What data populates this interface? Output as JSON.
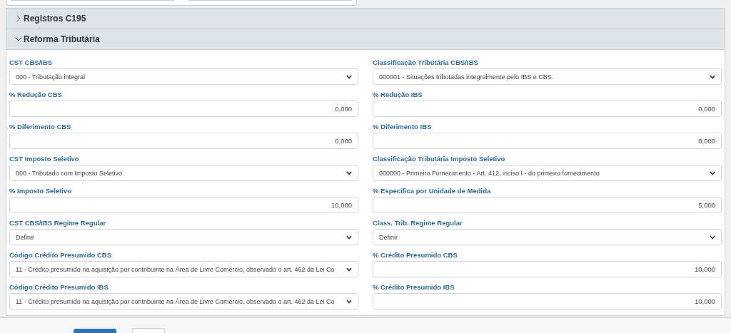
{
  "sections": [
    {
      "title": "Registros C195",
      "expanded": false
    },
    {
      "title": "Reforma Tributária",
      "expanded": true,
      "fields": [
        {
          "label": "CST CBS/IBS",
          "kind": "select",
          "value": "000 - Tributação integral"
        },
        {
          "label": "Classificação Tributária CBS/IBS",
          "kind": "select",
          "value": "000001 - Situações tributadas integralmente pelo IBS e CBS."
        },
        {
          "label": "% Redução CBS",
          "kind": "number",
          "value": "0,000"
        },
        {
          "label": "% Redução IBS",
          "kind": "number",
          "value": "0,000"
        },
        {
          "label": "% Diferimento CBS",
          "kind": "number",
          "value": "0,000"
        },
        {
          "label": "% Diferimento IBS",
          "kind": "number",
          "value": "0,000"
        },
        {
          "label": "CST Imposto Seletivo",
          "kind": "select",
          "value": "000 - Tributado com Imposto Seletivo"
        },
        {
          "label": "Classificação Tributária Imposto Seletivo",
          "kind": "select",
          "value": "000000 - Primeiro Fornecimento - Art. 412, inciso I - do primeiro fornecimento"
        },
        {
          "label": "% Imposto Seletivo",
          "kind": "number",
          "value": "10,000"
        },
        {
          "label": "% Específica por Unidade de Medida",
          "kind": "number",
          "value": "5,000"
        },
        {
          "label": "CST CBS/IBS Regime Regular",
          "kind": "select",
          "value": "Definir"
        },
        {
          "label": "Class. Trib. Regime Regular",
          "kind": "select",
          "value": "Definir"
        },
        {
          "label": "Código Crédito Presumido CBS",
          "kind": "select",
          "value": "11 - Crédito presumido na aquisição por contribuinte na Área de Livre Comércio, observado o art. 462 da Lei Co"
        },
        {
          "label": "% Crédito Presumido CBS",
          "kind": "number",
          "value": "10,000"
        },
        {
          "label": "Código Crédito Presumido IBS",
          "kind": "select",
          "value": "11 - Crédito presumido na aquisição por contribuinte na Área de Livre Comércio, observado o art. 462 da Lei Co"
        },
        {
          "label": "% Crédito Presumido IBS",
          "kind": "number",
          "value": "10,000"
        }
      ]
    }
  ]
}
